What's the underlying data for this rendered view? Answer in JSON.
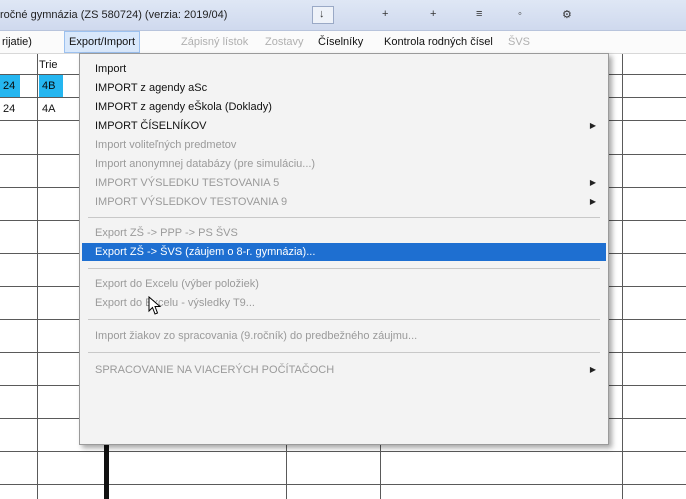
{
  "window": {
    "title": "ročné gymnázia (ZS 580724)  (verzia: 2019/04)",
    "title_glyphs": [
      "↓",
      "+",
      "+",
      "≡",
      "◦",
      "⚙"
    ]
  },
  "menubar": {
    "items": [
      {
        "label": "rijatie)",
        "enabled": true
      },
      {
        "label": "Export/Import",
        "enabled": true,
        "open": true
      },
      {
        "label": "Zápisný lístok",
        "enabled": false
      },
      {
        "label": "Zostavy",
        "enabled": false
      },
      {
        "label": "Číselníky",
        "enabled": true
      },
      {
        "label": "Kontrola rodných čísel",
        "enabled": true
      },
      {
        "label": "ŠVS",
        "enabled": false
      }
    ]
  },
  "table": {
    "header": "Trie",
    "rows": [
      {
        "col1": "24",
        "col2": "4B",
        "selected": true
      },
      {
        "col1": "24",
        "col2": "4A",
        "selected": false
      }
    ],
    "selection_color": "#25b6f0"
  },
  "dropdown": {
    "items": [
      {
        "label": "Import",
        "enabled": true
      },
      {
        "label": "IMPORT z agendy aSc",
        "enabled": true
      },
      {
        "label": "IMPORT z agendy eŠkola (Doklady)",
        "enabled": true
      },
      {
        "label": "IMPORT ČÍSELNÍKOV",
        "enabled": true,
        "submenu": true
      },
      {
        "label": "Import voliteľných predmetov",
        "enabled": false
      },
      {
        "label": "Import anonymnej databázy (pre simuláciu...)",
        "enabled": false
      },
      {
        "label": "IMPORT VÝSLEDKU TESTOVANIA 5",
        "enabled": false,
        "submenu": true
      },
      {
        "label": "IMPORT VÝSLEDKOV TESTOVANIA 9",
        "enabled": false,
        "submenu": true
      },
      {
        "label": "Export ZŠ -> PPP -> PS ŠVS",
        "enabled": false
      },
      {
        "label": "Export ZŠ -> ŠVS (záujem o 8-r. gymnázia)...",
        "enabled": true,
        "highlighted": true
      },
      {
        "label": "Export do Excelu (výber položiek)",
        "enabled": false
      },
      {
        "label": "Export do Excelu - výsledky T9...",
        "enabled": false
      },
      {
        "label": "Import žiakov zo spracovania (9.ročník) do predbežného záujmu...",
        "enabled": false
      },
      {
        "label": "SPRACOVANIE NA VIACERÝCH POČÍTAČOCH",
        "enabled": false,
        "submenu": true
      }
    ],
    "highlight_color": "#1e6fd1",
    "submenu_arrow": "▶"
  }
}
